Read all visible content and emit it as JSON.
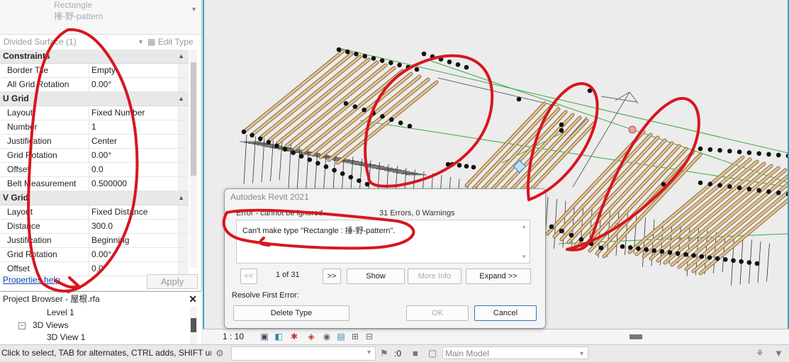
{
  "type_selector": {
    "line1": "Rectangle",
    "line2": "捶-野-pattern"
  },
  "instance_selector": {
    "label": "Divided Surface (1)",
    "edit_type": "Edit Type"
  },
  "properties": [
    {
      "category": "Constraints",
      "rows": [
        {
          "name": "Border Tile",
          "value": "Empty"
        },
        {
          "name": "All Grid Rotation",
          "value": "0.00°"
        }
      ]
    },
    {
      "category": "U Grid",
      "rows": [
        {
          "name": "Layout",
          "value": "Fixed Number"
        },
        {
          "name": "Number",
          "value": "1"
        },
        {
          "name": "Justification",
          "value": "Center"
        },
        {
          "name": "Grid Rotation",
          "value": "0.00°"
        },
        {
          "name": "Offset",
          "value": "0.0"
        },
        {
          "name": "Belt Measurement",
          "value": "0.500000"
        }
      ]
    },
    {
      "category": "V Grid",
      "rows": [
        {
          "name": "Layout",
          "value": "Fixed Distance"
        },
        {
          "name": "Distance",
          "value": "300.0"
        },
        {
          "name": "Justification",
          "value": "Beginning"
        },
        {
          "name": "Grid Rotation",
          "value": "0.00°"
        },
        {
          "name": "Offset",
          "value": "0.0"
        }
      ]
    }
  ],
  "props_footer": {
    "help": "Properties help",
    "apply": "Apply"
  },
  "browser": {
    "title": "Project Browser - 屋根.rfa",
    "level1": "Level 1",
    "views3d": "3D Views",
    "view3d1": "3D View 1",
    "collapse_symbol": "−"
  },
  "view_bar": {
    "scale": "1 : 10"
  },
  "dialog": {
    "title": "Autodesk Revit 2021",
    "error_head": "Error - cannot be ignored",
    "error_count": "31 Errors, 0 Warnings",
    "message": "Can't make type \"Rectangle : 捶-野-pattern\".",
    "prev": "<<",
    "pager": "1 of 31",
    "next": ">>",
    "show": "Show",
    "more_info": "More Info",
    "expand": "Expand >>",
    "resolve_label": "Resolve First Error:",
    "delete_type": "Delete Type",
    "ok": "OK",
    "cancel": "Cancel"
  },
  "status": {
    "text": "Click to select, TAB for alternates, CTRL adds, SHIFT unselects.",
    "zero": ":0",
    "model": "Main Model"
  },
  "colors": {
    "accent": "#2aa8c8",
    "annotation": "#d8161f",
    "wood": "#d9b98a",
    "guide": "#3bab3b"
  }
}
